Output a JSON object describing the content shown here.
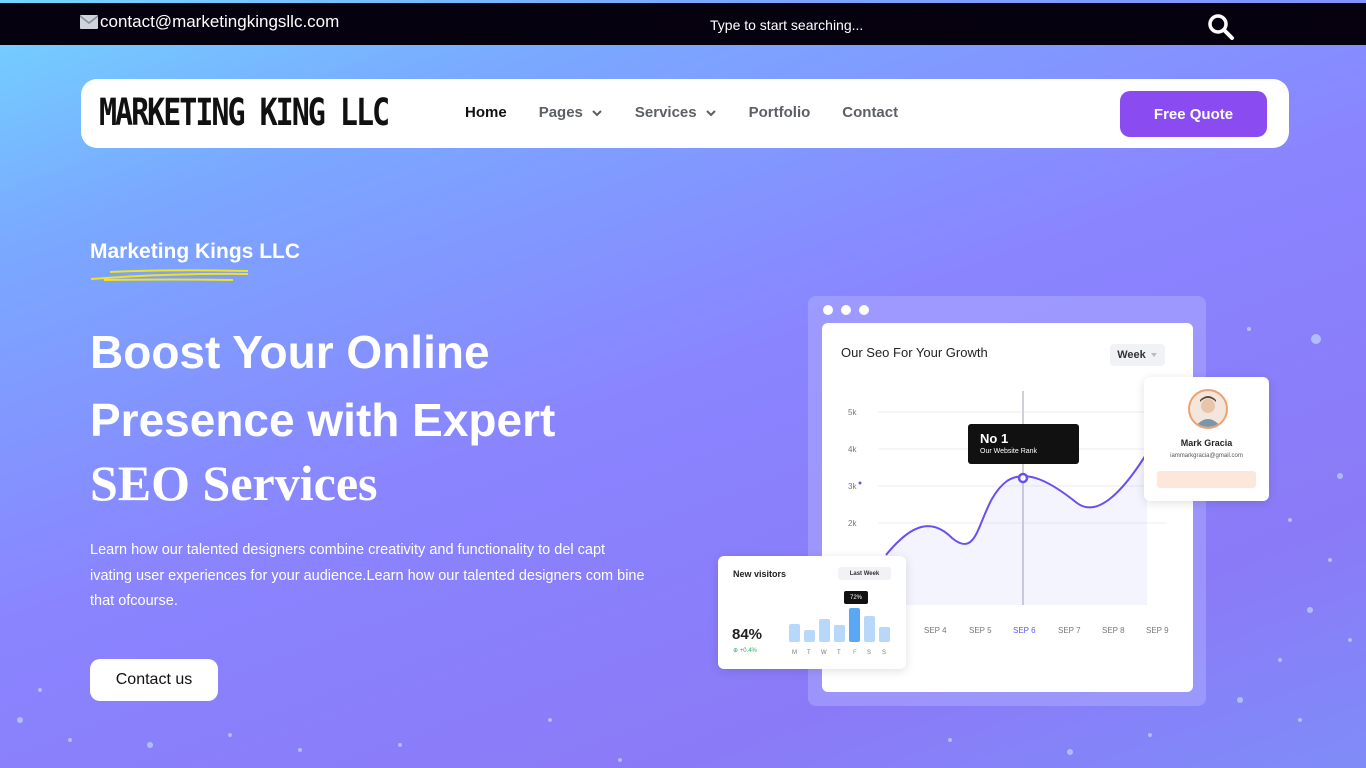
{
  "topbar": {
    "email": "contact@marketingkingsllc.com",
    "search_placeholder": "Type to start searching..."
  },
  "nav": {
    "logo": "MARKETING KING LLC",
    "items": [
      {
        "label": "Home",
        "active": true,
        "dropdown": false
      },
      {
        "label": "Pages",
        "active": false,
        "dropdown": true
      },
      {
        "label": "Services",
        "active": false,
        "dropdown": true
      },
      {
        "label": "Portfolio",
        "active": false,
        "dropdown": false
      },
      {
        "label": "Contact",
        "active": false,
        "dropdown": false
      }
    ],
    "cta_label": "Free Quote"
  },
  "hero": {
    "eyebrow": "Marketing Kings LLC",
    "title_line1": "Boost Your Online",
    "title_line2": "Presence with Expert",
    "title_line3": "SEO Services",
    "description": "Learn how our talented designers combine creativity and functionality to del capt ivating user experiences for your audience.Learn how our talented designers com bine that ofcourse.",
    "button_label": "Contact us"
  },
  "dashboard": {
    "title": "Our Seo For Your Growth",
    "period": "Week",
    "y_ticks": [
      "5k",
      "4k",
      "3k",
      "2k"
    ],
    "x_ticks": [
      "SEP 4",
      "SEP 5",
      "SEP 6",
      "SEP 7",
      "SEP 8",
      "SEP 9"
    ],
    "active_x": "SEP 6",
    "tooltip_title": "No 1",
    "tooltip_sub": "Our Website Rank",
    "profile_name": "Mark Gracia",
    "profile_email": "iammarkgracia@gmail.com",
    "visitors_title": "New visitors",
    "visitors_period": "Last Week",
    "visitors_pct": "84%",
    "visitors_delta": "+0.4%",
    "visitors_days": [
      "M",
      "T",
      "W",
      "T",
      "F",
      "S",
      "S"
    ],
    "visitors_tip": "72%"
  },
  "colors": {
    "accent": "#8a4cf0",
    "topbar": "#05010e",
    "underline": "#f2e31a"
  }
}
